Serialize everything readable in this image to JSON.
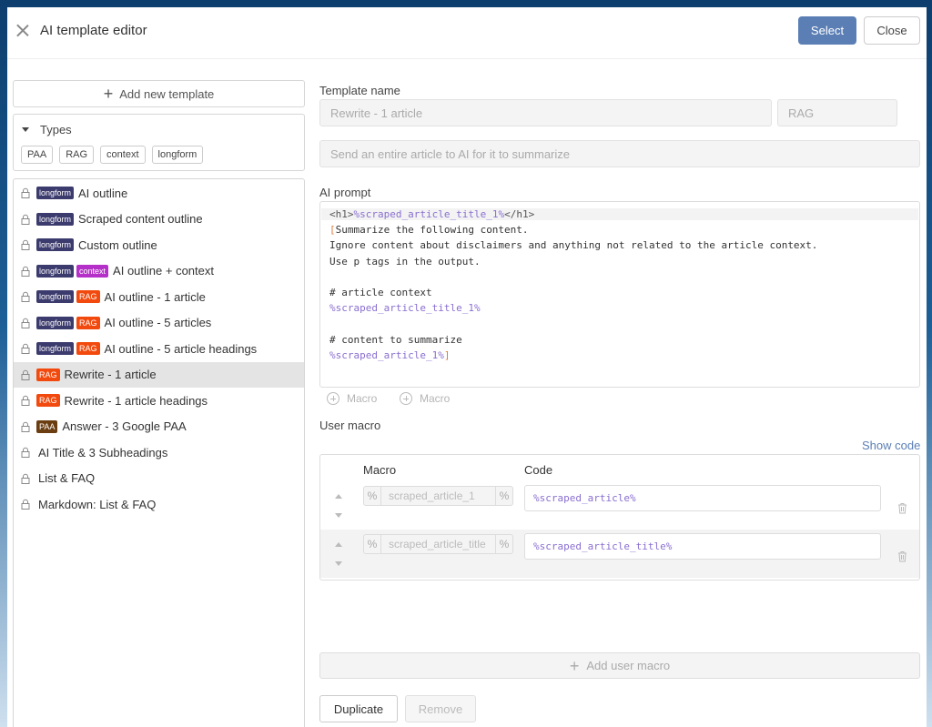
{
  "header": {
    "title": "AI template editor",
    "select_label": "Select",
    "close_label": "Close"
  },
  "sidebar": {
    "add_template_label": "Add new template",
    "types_label": "Types",
    "types": [
      "PAA",
      "RAG",
      "context",
      "longform"
    ],
    "templates": [
      {
        "badges": [
          "longform"
        ],
        "name": "AI outline"
      },
      {
        "badges": [
          "longform"
        ],
        "name": "Scraped content outline"
      },
      {
        "badges": [
          "longform"
        ],
        "name": "Custom outline"
      },
      {
        "badges": [
          "longform",
          "context"
        ],
        "name": "AI outline + context"
      },
      {
        "badges": [
          "longform",
          "RAG"
        ],
        "name": "AI outline - 1 article"
      },
      {
        "badges": [
          "longform",
          "RAG"
        ],
        "name": "AI outline - 5 articles"
      },
      {
        "badges": [
          "longform",
          "RAG"
        ],
        "name": "AI outline - 5 article headings"
      },
      {
        "badges": [
          "RAG"
        ],
        "name": "Rewrite - 1 article",
        "active": true
      },
      {
        "badges": [
          "RAG"
        ],
        "name": "Rewrite - 1 article headings"
      },
      {
        "badges": [
          "PAA"
        ],
        "name": "Answer - 3 Google PAA"
      },
      {
        "badges": [],
        "name": "AI Title & 3 Subheadings"
      },
      {
        "badges": [],
        "name": "List & FAQ"
      },
      {
        "badges": [],
        "name": "Markdown: List & FAQ"
      }
    ]
  },
  "editor": {
    "template_name_label": "Template name",
    "template_name_value": "Rewrite - 1 article",
    "type_value": "RAG",
    "description_placeholder": "Send an entire article to AI for it to summarize",
    "ai_prompt_label": "AI prompt",
    "prompt_lines": [
      "<h1>%scraped_article_title_1%</h1>",
      "[Summarize the following content.",
      "Ignore content about disclaimers and anything not related to the article context.",
      "Use p tags in the output.",
      "",
      "# article context",
      "%scraped_article_title_1%",
      "",
      "# content to summarize",
      "%scraped_article_1%]"
    ],
    "macro_button_label": "Macro",
    "user_macro_label": "User macro",
    "show_code_label": "Show code",
    "macro_col_label": "Macro",
    "code_col_label": "Code",
    "user_macros": [
      {
        "name": "scraped_article_1",
        "code": "%scraped_article%"
      },
      {
        "name": "scraped_article_title",
        "code": "%scraped_article_title%"
      }
    ],
    "add_user_macro_label": "Add user macro",
    "duplicate_label": "Duplicate",
    "remove_label": "Remove"
  },
  "colors": {
    "accent": "#5b7fb5",
    "longform": "#3c3b6e",
    "context": "#b530c8",
    "RAG": "#f24a0e",
    "PAA": "#6b3e12",
    "macro_text": "#8a6fd1"
  }
}
